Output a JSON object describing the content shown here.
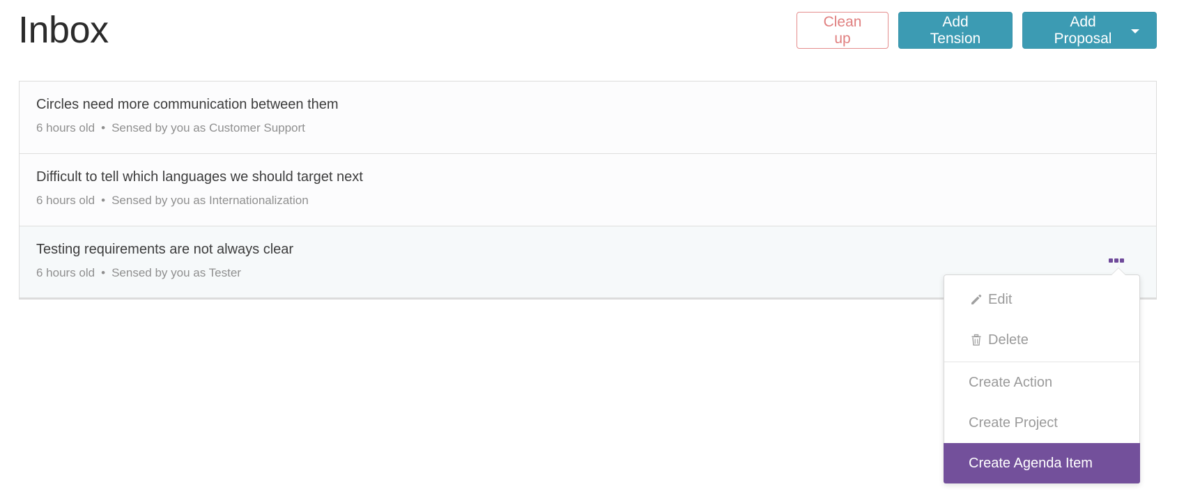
{
  "page": {
    "title": "Inbox"
  },
  "header": {
    "cleanup_label": "Clean up",
    "add_tension_label": "Add Tension",
    "add_proposal_label": "Add Proposal"
  },
  "tensions": [
    {
      "title": "Circles need more communication between them",
      "age": "6 hours old",
      "separator": "•",
      "sensed": "Sensed by you as Customer Support"
    },
    {
      "title": "Difficult to tell which languages we should target next",
      "age": "6 hours old",
      "separator": "•",
      "sensed": "Sensed by you as Internationalization"
    },
    {
      "title": "Testing requirements are not always clear",
      "age": "6 hours old",
      "separator": "•",
      "sensed": "Sensed by you as Tester"
    }
  ],
  "menu": {
    "edit_label": "Edit",
    "edit_icon": "pencil-icon",
    "delete_label": "Delete",
    "delete_icon": "trash-icon",
    "create_action_label": "Create Action",
    "create_project_label": "Create Project",
    "create_agenda_item_label": "Create Agenda Item"
  },
  "colors": {
    "primary": "#3c9bb3",
    "danger": "#e07f7f",
    "accent_purple": "#73509b"
  }
}
